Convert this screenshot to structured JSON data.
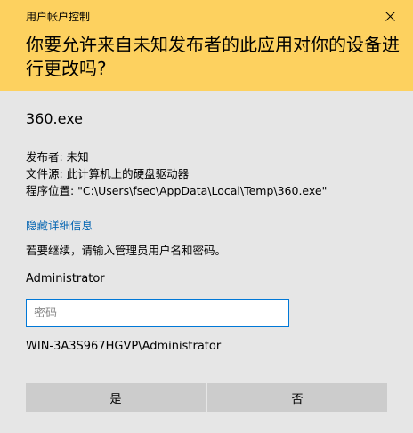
{
  "dialog": {
    "title": "用户帐户控制",
    "question": "你要允许来自未知发布者的此应用对你的设备进行更改吗?",
    "app_name": "360.exe",
    "publisher": "发布者: 未知",
    "file_source": "文件源: 此计算机上的硬盘驱动器",
    "program_location": "程序位置: \"C:\\Users\\fsec\\AppData\\Local\\Temp\\360.exe\"",
    "toggle_details": "隐藏详细信息",
    "prompt": "若要继续，请输入管理员用户名和密码。",
    "username": "Administrator",
    "password_placeholder": "密码",
    "account": "WIN-3A3S967HGVP\\Administrator",
    "yes_label": "是",
    "no_label": "否"
  },
  "colors": {
    "header": "#fdd15f",
    "background": "#e6e6e6",
    "link": "#0063b1",
    "button": "#cccccc",
    "input_border": "#0078d7"
  },
  "icons": {
    "close": "close-icon"
  }
}
